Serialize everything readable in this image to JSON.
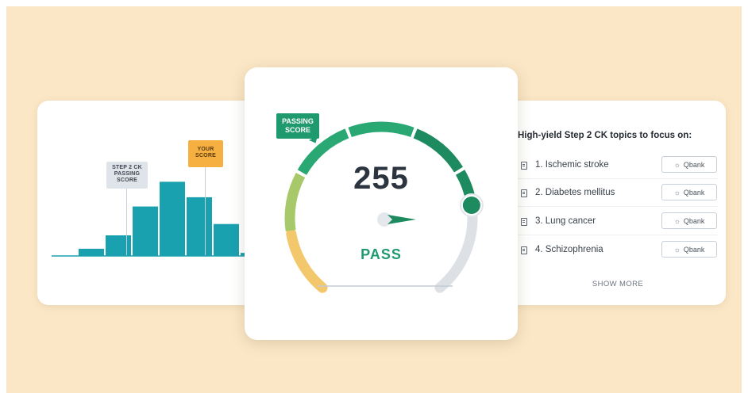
{
  "histogram": {
    "passing_tag": "STEP 2 CK PASSING SCORE",
    "your_tag": "YOUR SCORE",
    "bars": [
      0.0,
      0.07,
      0.2,
      0.48,
      0.72,
      0.57,
      0.31,
      0.03
    ],
    "colors": {
      "bar": "#1aa1b0",
      "baseline": "#1aa1b0"
    }
  },
  "gauge": {
    "passing_tag": "PASSING SCORE",
    "score": "255",
    "verdict": "PASS",
    "colors": {
      "yellow": "#f3c76b",
      "light_green": "#a8c96a",
      "green": "#2aa874",
      "dark_green": "#1d8a5f",
      "track": "#dde1e6"
    }
  },
  "topics": {
    "title": "High-yield Step 2 CK topics to focus on:",
    "items": [
      {
        "label": "1. Ischemic stroke",
        "button": "Qbank"
      },
      {
        "label": "2. Diabetes mellitus",
        "button": "Qbank"
      },
      {
        "label": "3. Lung cancer",
        "button": "Qbank"
      },
      {
        "label": "4. Schizophrenia",
        "button": "Qbank"
      }
    ],
    "show_more": "SHOW MORE",
    "icons": {
      "topic": "book-icon",
      "button": "lightbulb-icon"
    }
  }
}
